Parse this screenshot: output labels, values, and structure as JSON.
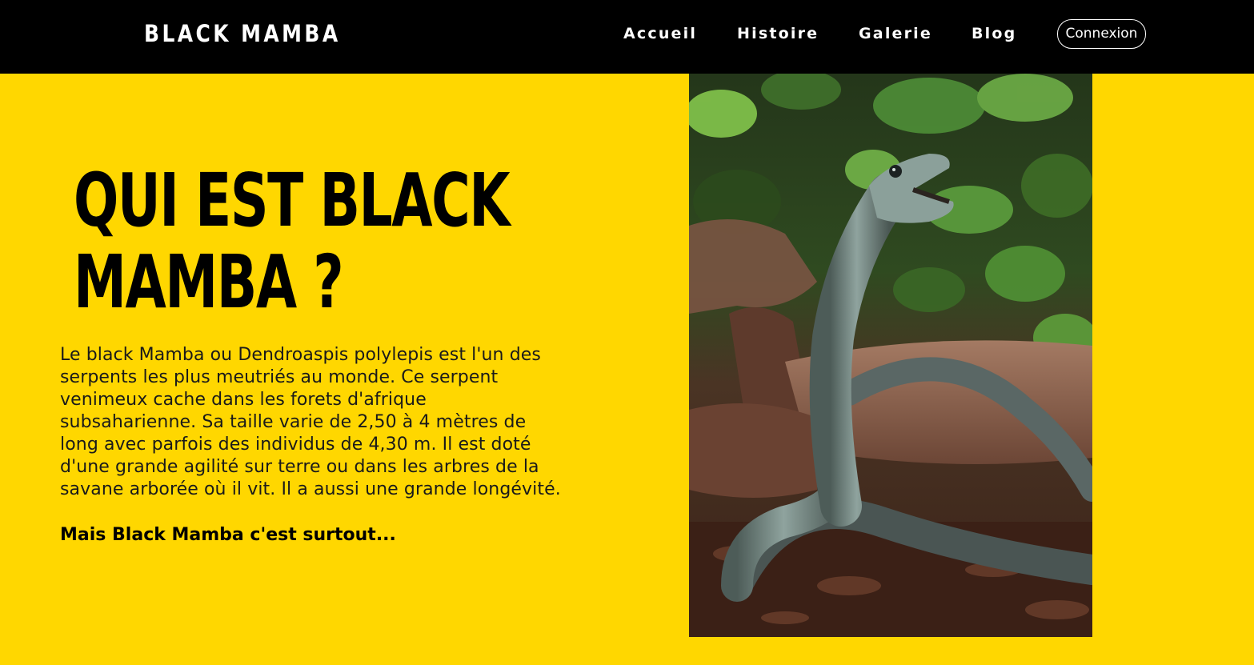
{
  "header": {
    "brand": "BLACK MAMBA",
    "nav": [
      {
        "label": "Accueil"
      },
      {
        "label": "Histoire"
      },
      {
        "label": "Galerie"
      },
      {
        "label": "Blog"
      }
    ],
    "login_label": "Connexion"
  },
  "hero": {
    "title_line1": "QUI EST BLACK",
    "title_line2": "MAMBA ?",
    "paragraph": "Le black Mamba ou Dendroaspis polylepis est l'un des serpents les plus meutriés au monde. Ce serpent venimeux cache dans les forets d'afrique subsaharienne. Sa taille varie de 2,50 à 4 mètres de long avec parfois des individus de 4,30 m. Il est doté d'une grande agilité sur terre ou dans les arbres de la savane arborée où il vit. Il a aussi une grande longévité.",
    "emphasis": "Mais Black Mamba c'est surtout..."
  },
  "colors": {
    "accent": "#ffd700",
    "header_bg": "#000000",
    "text": "#000000"
  },
  "icons": {
    "photo": "black-mamba-snake-photo"
  }
}
